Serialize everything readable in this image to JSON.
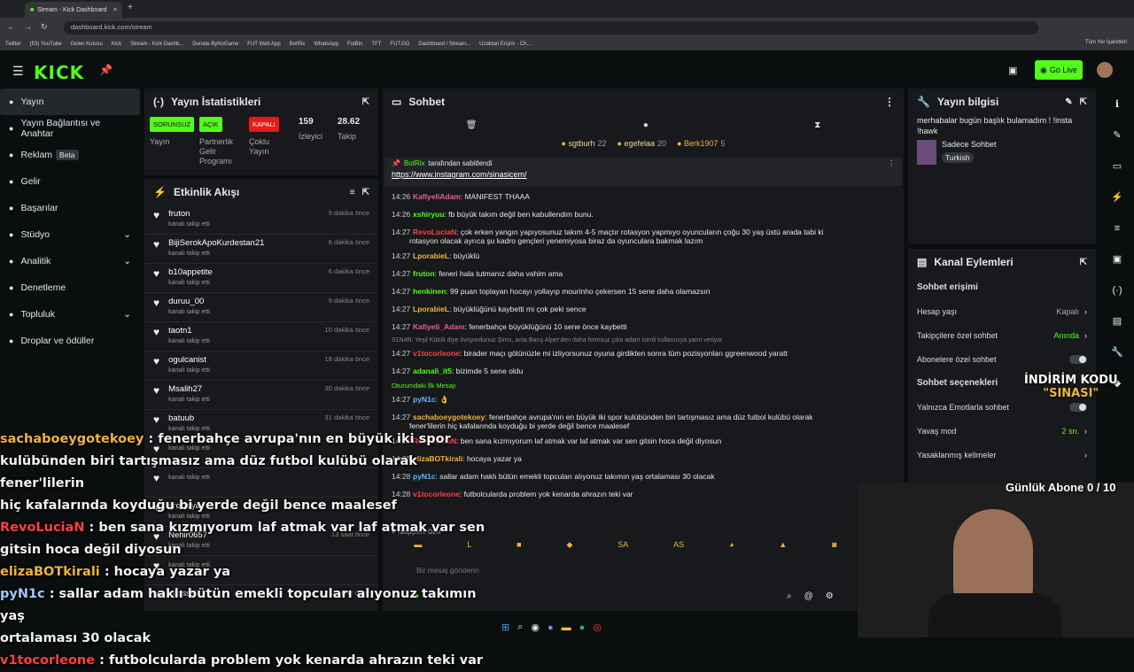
{
  "browser": {
    "tab_title": "Stream - Kick Dashboard",
    "url": "dashboard.kick.com/stream",
    "bookmarks": [
      "Twitter",
      "(53) YouTube",
      "Gelen Kutusu",
      "Kick",
      "Stream - Kick Dashb...",
      "Donate ByNoGame",
      "FUT Web App",
      "BotRix",
      "WhatsApp",
      "FutBin",
      "TFT",
      "FUT.GG",
      "Dashboard / Stream...",
      "Uzaktan Erişim - Ch..."
    ],
    "bookmarks_right": "Tüm Yer İşaretleri"
  },
  "header": {
    "logo": "KICK",
    "golive": "Go Live"
  },
  "sidebar": {
    "items": [
      {
        "label": "Yayın",
        "icon": "broadcast-icon"
      },
      {
        "label": "Yayın Bağlantısı ve Anahtar",
        "icon": "link-icon"
      },
      {
        "label": "Reklam",
        "icon": "ad-icon",
        "badge": "Beta"
      },
      {
        "label": "Gelir",
        "icon": "dollar-icon"
      },
      {
        "label": "Başarılar",
        "icon": "trophy-icon"
      },
      {
        "label": "Stüdyo",
        "icon": "studio-icon"
      },
      {
        "label": "Analitik",
        "icon": "chart-icon"
      },
      {
        "label": "Denetleme",
        "icon": "hammer-icon"
      },
      {
        "label": "Topluluk",
        "icon": "users-icon"
      },
      {
        "label": "Droplar ve ödüller",
        "icon": "gift-icon"
      }
    ]
  },
  "stats": {
    "title": "Yayın İstatistikleri",
    "items": [
      {
        "badge": "SORUNSUZ",
        "color": "#53fc18",
        "label": "Yayın"
      },
      {
        "badge": "AÇIK",
        "color": "#53fc18",
        "label": "Partnerlik Gelir Programı"
      },
      {
        "badge": "KAPALI",
        "color": "#e91916",
        "label": "Çoklu Yayın"
      },
      {
        "value": "159",
        "label": "İzleyici"
      },
      {
        "value": "28.62",
        "label": "Takip"
      }
    ]
  },
  "activity": {
    "title": "Etkinlik Akışı",
    "items": [
      {
        "name": "fruton",
        "sub": "kanalı takip etti",
        "time": "5 dakika önce"
      },
      {
        "name": "BijiSerokApoKurdestan21",
        "sub": "kanalı takip etti",
        "time": "6 dakika önce"
      },
      {
        "name": "b10appetite",
        "sub": "kanalı takip etti",
        "time": "6 dakika önce"
      },
      {
        "name": "duruu_00",
        "sub": "kanalı takip etti",
        "time": "9 dakika önce"
      },
      {
        "name": "taotn1",
        "sub": "kanalı takip etti",
        "time": "10 dakika önce"
      },
      {
        "name": "ogulcanist",
        "sub": "kanalı takip etti",
        "time": "18 dakika önce"
      },
      {
        "name": "Msalih27",
        "sub": "kanalı takip etti",
        "time": "30 dakika önce"
      },
      {
        "name": "batuub",
        "sub": "kanalı takip etti",
        "time": "31 dakika önce"
      },
      {
        "name": "",
        "sub": "kanalı takip etti",
        "time": ""
      },
      {
        "name": "",
        "sub": "kanalı takip etti",
        "time": ""
      },
      {
        "name": "gronsiya",
        "sub": "kanalı takip etti",
        "time": ""
      },
      {
        "name": "Nehir0657",
        "sub": "kanalı takip etti",
        "time": "13 saat önce"
      },
      {
        "name": "",
        "sub": "kanalı takip etti",
        "time": ""
      },
      {
        "name": "ecosski",
        "sub": "",
        "time": "23 saat önce"
      }
    ]
  },
  "chat": {
    "title": "Sohbet",
    "top_users": [
      {
        "name": "sgtburh",
        "n": "22"
      },
      {
        "name": "egefelaa",
        "n": "20"
      },
      {
        "name": "Berk1907",
        "n": "5"
      }
    ],
    "pinned_by": "BotRix",
    "pinned_suffix": "tarafından sabitlendi",
    "pinned_link": "https://www.instagram.com/sinasicem/",
    "messages": [
      {
        "t": "14:26",
        "u": "KaflyeliAdam",
        "c": "#e0609a",
        "m": ": MANIFEST THAAA"
      },
      {
        "t": "14:26",
        "u": "xshiryuu",
        "c": "#53fc18",
        "m": ": fb büyük takım değil ben kabullendim bunu."
      },
      {
        "t": "14:27",
        "u": "RevoLuciaN",
        "c": "#ff4040",
        "m": ": çok erken yangın yapıyosunuz takım 4-5 maçtır rotasyon yapmıyo oyuncuların çoğu 30 yaş üstü arada tabi ki"
      },
      {
        "t": "",
        "u": "",
        "c": "#ccc",
        "m": "rotasyon olacak ayrıca şu kadro gençleri yenemiyosa biraz da oyunculara bakmak lazım"
      },
      {
        "t": "14:27",
        "u": "LporabieL",
        "c": "#f0b43c",
        "m": ": büyüklü"
      },
      {
        "t": "14:27",
        "u": "fruton",
        "c": "#53fc18",
        "m": ": feneri hala tutmanız daha vahim ama"
      },
      {
        "t": "14:27",
        "u": "henkinen",
        "c": "#53fc18",
        "m": ": 99 puan toplayan hocayı yollayıp mourinho çekersen 15 sene daha olamazsın"
      },
      {
        "t": "14:27",
        "u": "LporabieL",
        "c": "#f0b43c",
        "m": ": büyüklüğünü kaybetti mi çok peki sence"
      },
      {
        "t": "14:27",
        "u": "Kafiyeli_Adam",
        "c": "#e0609a",
        "m": ": fenerbahçe büyüklüğünü 10 sene önce kaybetti"
      },
      {
        "t": "14:27",
        "u": "v1tocorleone",
        "c": "#ff4040",
        "m": ": birader maçı götünüzle mi izliyorsunuz oyuna girdikten sonra tüm pozisyonları ggreenwood yaratt"
      },
      {
        "t": "14:27",
        "u": "adanali_it5",
        "c": "#53fc18",
        "m": ": bizimde 5 sene oldu"
      },
      {
        "t": "14:27",
        "u": "pyN1c",
        "c": "#60b8ff",
        "m": ": 👌"
      },
      {
        "t": "14:27",
        "u": "sachaboeygotekoey",
        "c": "#f0b43c",
        "m": ": fenerbahçe avrupa'nın en büyük iki spor kulübünden biri tartışmasız ama düz futbol kulübü olarak"
      },
      {
        "t": "",
        "u": "",
        "c": "#ccc",
        "m": "fener'lilerin hiç kafalarında koyduğu bi yerde değil bence maalesef"
      },
      {
        "t": "14:27",
        "u": "RevoLuciaN",
        "c": "#ff4040",
        "m": ": ben sana kızmıyorum laf atmak var laf atmak var sen gitsin hoca değil diyosun"
      },
      {
        "t": "14:28",
        "u": "elizaBOTkirali",
        "c": "#f0b43c",
        "m": ": hocaya yazar ya"
      },
      {
        "t": "14:28",
        "u": "pyN1c",
        "c": "#60b8ff",
        "m": ": sallar adam haklı bütün emekli topcuları alıyonuz takımın yaş ortalaması 30 olacak"
      },
      {
        "t": "14:28",
        "u": "v1tocorleone",
        "c": "#ff4040",
        "m": ": futbolcularda problem yok kenarda ahrazın teki var"
      }
    ],
    "first_msg_label": "Oturumdaki İlk Mesajı",
    "reply_note": "S1N4N: Yeşil Kütük diye övüyordunuz Şimo, ama Barış Alper'den daha formsuz çıktı adam isimli kullanıcıya yanıt veriyor",
    "followers_only": "Takipçilere Özel",
    "placeholder": "Bir mesaj gönderin"
  },
  "info": {
    "title": "Yayın bilgisi",
    "stream_title": "merhabalar bugün başlık bulamadım ! !insta !hawk",
    "category": "Sadece Sohbet",
    "language": "Turkish"
  },
  "actions": {
    "title": "Kanal Eylemleri",
    "access": "Sohbet erişimi",
    "rows": [
      {
        "label": "Hesap yaşı",
        "val": "Kapalı",
        "color": "#aaa"
      },
      {
        "label": "Takipçilere özel sohbet",
        "val": "Anında",
        "color": "#53fc18"
      }
    ],
    "sub_only": "Abonelere özel sohbet",
    "options": "Sohbet seçenekleri",
    "emote_only": "Yalnızca Emotlarla sohbet",
    "slow": "Yavaş mod",
    "slow_val": "2 sn.",
    "banned": "Yasaklanmış kelimeler"
  },
  "overlay": {
    "promo1": "İNDİRİM KODU",
    "promo2": "\"SINASI\"",
    "goal": "Günlük Abone 0 / 10",
    "lines": [
      {
        "u": "sachaboeygotekoey",
        "c": "#f0b43c",
        "m": " : fenerbahçe avrupa'nın en büyük iki spor"
      },
      {
        "u": "",
        "c": "#fff",
        "m": "kulübünden biri tartışmasız ama düz futbol kulübü olarak fener'lilerin"
      },
      {
        "u": "",
        "c": "#fff",
        "m": "hiç kafalarında koyduğu bi yerde değil bence maalesef"
      },
      {
        "u": "RevoLuciaN",
        "c": "#ff4040",
        "m": " : ben sana kızmıyorum laf atmak var laf atmak var sen"
      },
      {
        "u": "",
        "c": "#fff",
        "m": "gitsin hoca değil diyosun"
      },
      {
        "u": "elizaBOTkirali",
        "c": "#f0b43c",
        "m": " : hocaya yazar ya"
      },
      {
        "u": "pyN1c",
        "c": "#a0c8ff",
        "m": " : sallar adam haklı bütün emekli topcuları alıyonuz takımın yaş"
      },
      {
        "u": "",
        "c": "#fff",
        "m": "ortalaması 30 olacak"
      },
      {
        "u": "v1tocorleone",
        "c": "#ff4040",
        "m": " : futbolcularda problem yok kenarda ahrazın teki var"
      }
    ]
  }
}
